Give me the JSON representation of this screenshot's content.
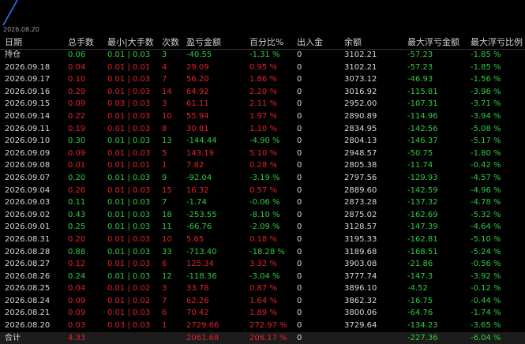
{
  "chart_strip": {
    "date_label": "2026.08.20",
    "line_color": "#2a7fff"
  },
  "colors": {
    "positive": "#2ecc40",
    "negative": "#e0222a",
    "neutral": "#d8d8d8"
  },
  "headers": [
    "日期",
    "总手数",
    "最小|大手数",
    "次数",
    "盈亏金额",
    "百分比%",
    "出入金",
    "余额",
    "最大浮亏金额",
    "最大浮亏比例"
  ],
  "rows": [
    {
      "t": "pos",
      "c": [
        "持仓",
        "0.06",
        "0.01 | 0.03",
        "3",
        "-40.55",
        "-1.31 %",
        "0",
        "3102.21",
        "-57.23",
        "-1.85 %"
      ]
    },
    {
      "t": "neg",
      "c": [
        "2026.09.18",
        "0.04",
        "0.01 | 0.01",
        "4",
        "29.09",
        "0.95 %",
        "0",
        "3102.21",
        "-57.23",
        "-1.85 %"
      ]
    },
    {
      "t": "neg",
      "c": [
        "2026.09.17",
        "0.10",
        "0.01 | 0.03",
        "7",
        "56.20",
        "1.86 %",
        "0",
        "3073.12",
        "-46.93",
        "-1.56 %"
      ]
    },
    {
      "t": "neg",
      "c": [
        "2026.09.16",
        "0.29",
        "0.01 | 0.03",
        "14",
        "64.92",
        "2.20 %",
        "0",
        "3016.92",
        "-115.81",
        "-3.96 %"
      ]
    },
    {
      "t": "neg",
      "c": [
        "2026.09.15",
        "0.09",
        "0.03 | 0.03",
        "3",
        "61.11",
        "2.11 %",
        "0",
        "2952.00",
        "-107.31",
        "-3.71 %"
      ]
    },
    {
      "t": "neg",
      "c": [
        "2026.09.14",
        "0.22",
        "0.01 | 0.03",
        "10",
        "55.94",
        "1.97 %",
        "0",
        "2890.89",
        "-114.96",
        "-3.94 %"
      ]
    },
    {
      "t": "neg",
      "c": [
        "2026.09.11",
        "0.19",
        "0.01 | 0.03",
        "8",
        "30.81",
        "1.10 %",
        "0",
        "2834.95",
        "-142.56",
        "-5.08 %"
      ]
    },
    {
      "t": "pos",
      "c": [
        "2026.09.10",
        "0.30",
        "0.01 | 0.03",
        "13",
        "-144.44",
        "-4.90 %",
        "0",
        "2804.13",
        "-146.37",
        "-5.17 %"
      ]
    },
    {
      "t": "neg",
      "c": [
        "2026.09.09",
        "0.09",
        "0.01 | 0.03",
        "5",
        "143.19",
        "5.10 %",
        "0",
        "2948.57",
        "-50.75",
        "-1.80 %"
      ]
    },
    {
      "t": "neg",
      "c": [
        "2026.09.08",
        "0.01",
        "0.01 | 0.01",
        "1",
        "7.82",
        "0.28 %",
        "0",
        "2805.38",
        "-11.74",
        "-0.42 %"
      ]
    },
    {
      "t": "pos",
      "c": [
        "2026.09.07",
        "0.20",
        "0.01 | 0.03",
        "9",
        "-92.04",
        "-3.19 %",
        "0",
        "2797.56",
        "-129.93",
        "-4.57 %"
      ]
    },
    {
      "t": "neg",
      "c": [
        "2026.09.04",
        "0.26",
        "0.01 | 0.03",
        "15",
        "16.32",
        "0.57 %",
        "0",
        "2889.60",
        "-142.59",
        "-4.96 %"
      ]
    },
    {
      "t": "pos",
      "c": [
        "2026.09.03",
        "0.11",
        "0.01 | 0.03",
        "7",
        "-1.74",
        "-0.06 %",
        "0",
        "2873.28",
        "-137.32",
        "-4.78 %"
      ]
    },
    {
      "t": "pos",
      "c": [
        "2026.09.02",
        "0.43",
        "0.01 | 0.03",
        "18",
        "-253.55",
        "-8.10 %",
        "0",
        "2875.02",
        "-162.69",
        "-5.32 %"
      ]
    },
    {
      "t": "pos",
      "c": [
        "2026.09.01",
        "0.25",
        "0.01 | 0.03",
        "11",
        "-66.76",
        "-2.09 %",
        "0",
        "3128.57",
        "-147.39",
        "-4.64 %"
      ]
    },
    {
      "t": "neg",
      "c": [
        "2026.08.31",
        "0.20",
        "0.01 | 0.03",
        "10",
        "5.65",
        "0.18 %",
        "0",
        "3195.33",
        "-162.81",
        "-5.10 %"
      ]
    },
    {
      "t": "pos",
      "c": [
        "2026.08.28",
        "0.88",
        "0.01 | 0.03",
        "33",
        "-713.40",
        "-18.28 %",
        "0",
        "3189.68",
        "-168.51",
        "-5.24 %"
      ]
    },
    {
      "t": "neg",
      "c": [
        "2026.08.27",
        "0.12",
        "0.01 | 0.03",
        "6",
        "125.34",
        "3.32 %",
        "0",
        "3903.08",
        "-21.86",
        "-0.56 %"
      ]
    },
    {
      "t": "pos",
      "c": [
        "2026.08.26",
        "0.24",
        "0.01 | 0.03",
        "12",
        "-118.36",
        "-3.04 %",
        "0",
        "3777.74",
        "-147.3",
        "-3.92 %"
      ]
    },
    {
      "t": "neg",
      "c": [
        "2026.08.25",
        "0.04",
        "0.01 | 0.02",
        "3",
        "33.78",
        "0.87 %",
        "0",
        "3896.10",
        "-4.52",
        "-0.12 %"
      ]
    },
    {
      "t": "neg",
      "c": [
        "2026.08.24",
        "0.09",
        "0.01 | 0.02",
        "7",
        "62.26",
        "1.64 %",
        "0",
        "3862.32",
        "-16.75",
        "-0.44 %"
      ]
    },
    {
      "t": "neg",
      "c": [
        "2026.08.21",
        "0.09",
        "0.01 | 0.03",
        "6",
        "70.42",
        "1.89 %",
        "0",
        "3800.06",
        "-64.76",
        "-1.74 %"
      ]
    },
    {
      "t": "neg",
      "c": [
        "2026.08.20",
        "0.03",
        "0.03 | 0.03",
        "1",
        "2729.66",
        "272.97 %",
        "0",
        "3729.64",
        "-134.23",
        "-3.65 %"
      ]
    }
  ],
  "total": {
    "c": [
      "合计",
      "4.33",
      "",
      "",
      "2061.68",
      "206.17 %",
      "0",
      "",
      "-227.36",
      "-6.04 %"
    ],
    "tones": [
      "wht",
      "neg",
      "wht",
      "wht",
      "neg",
      "neg",
      "wht",
      "wht",
      "pos",
      "pos"
    ]
  }
}
